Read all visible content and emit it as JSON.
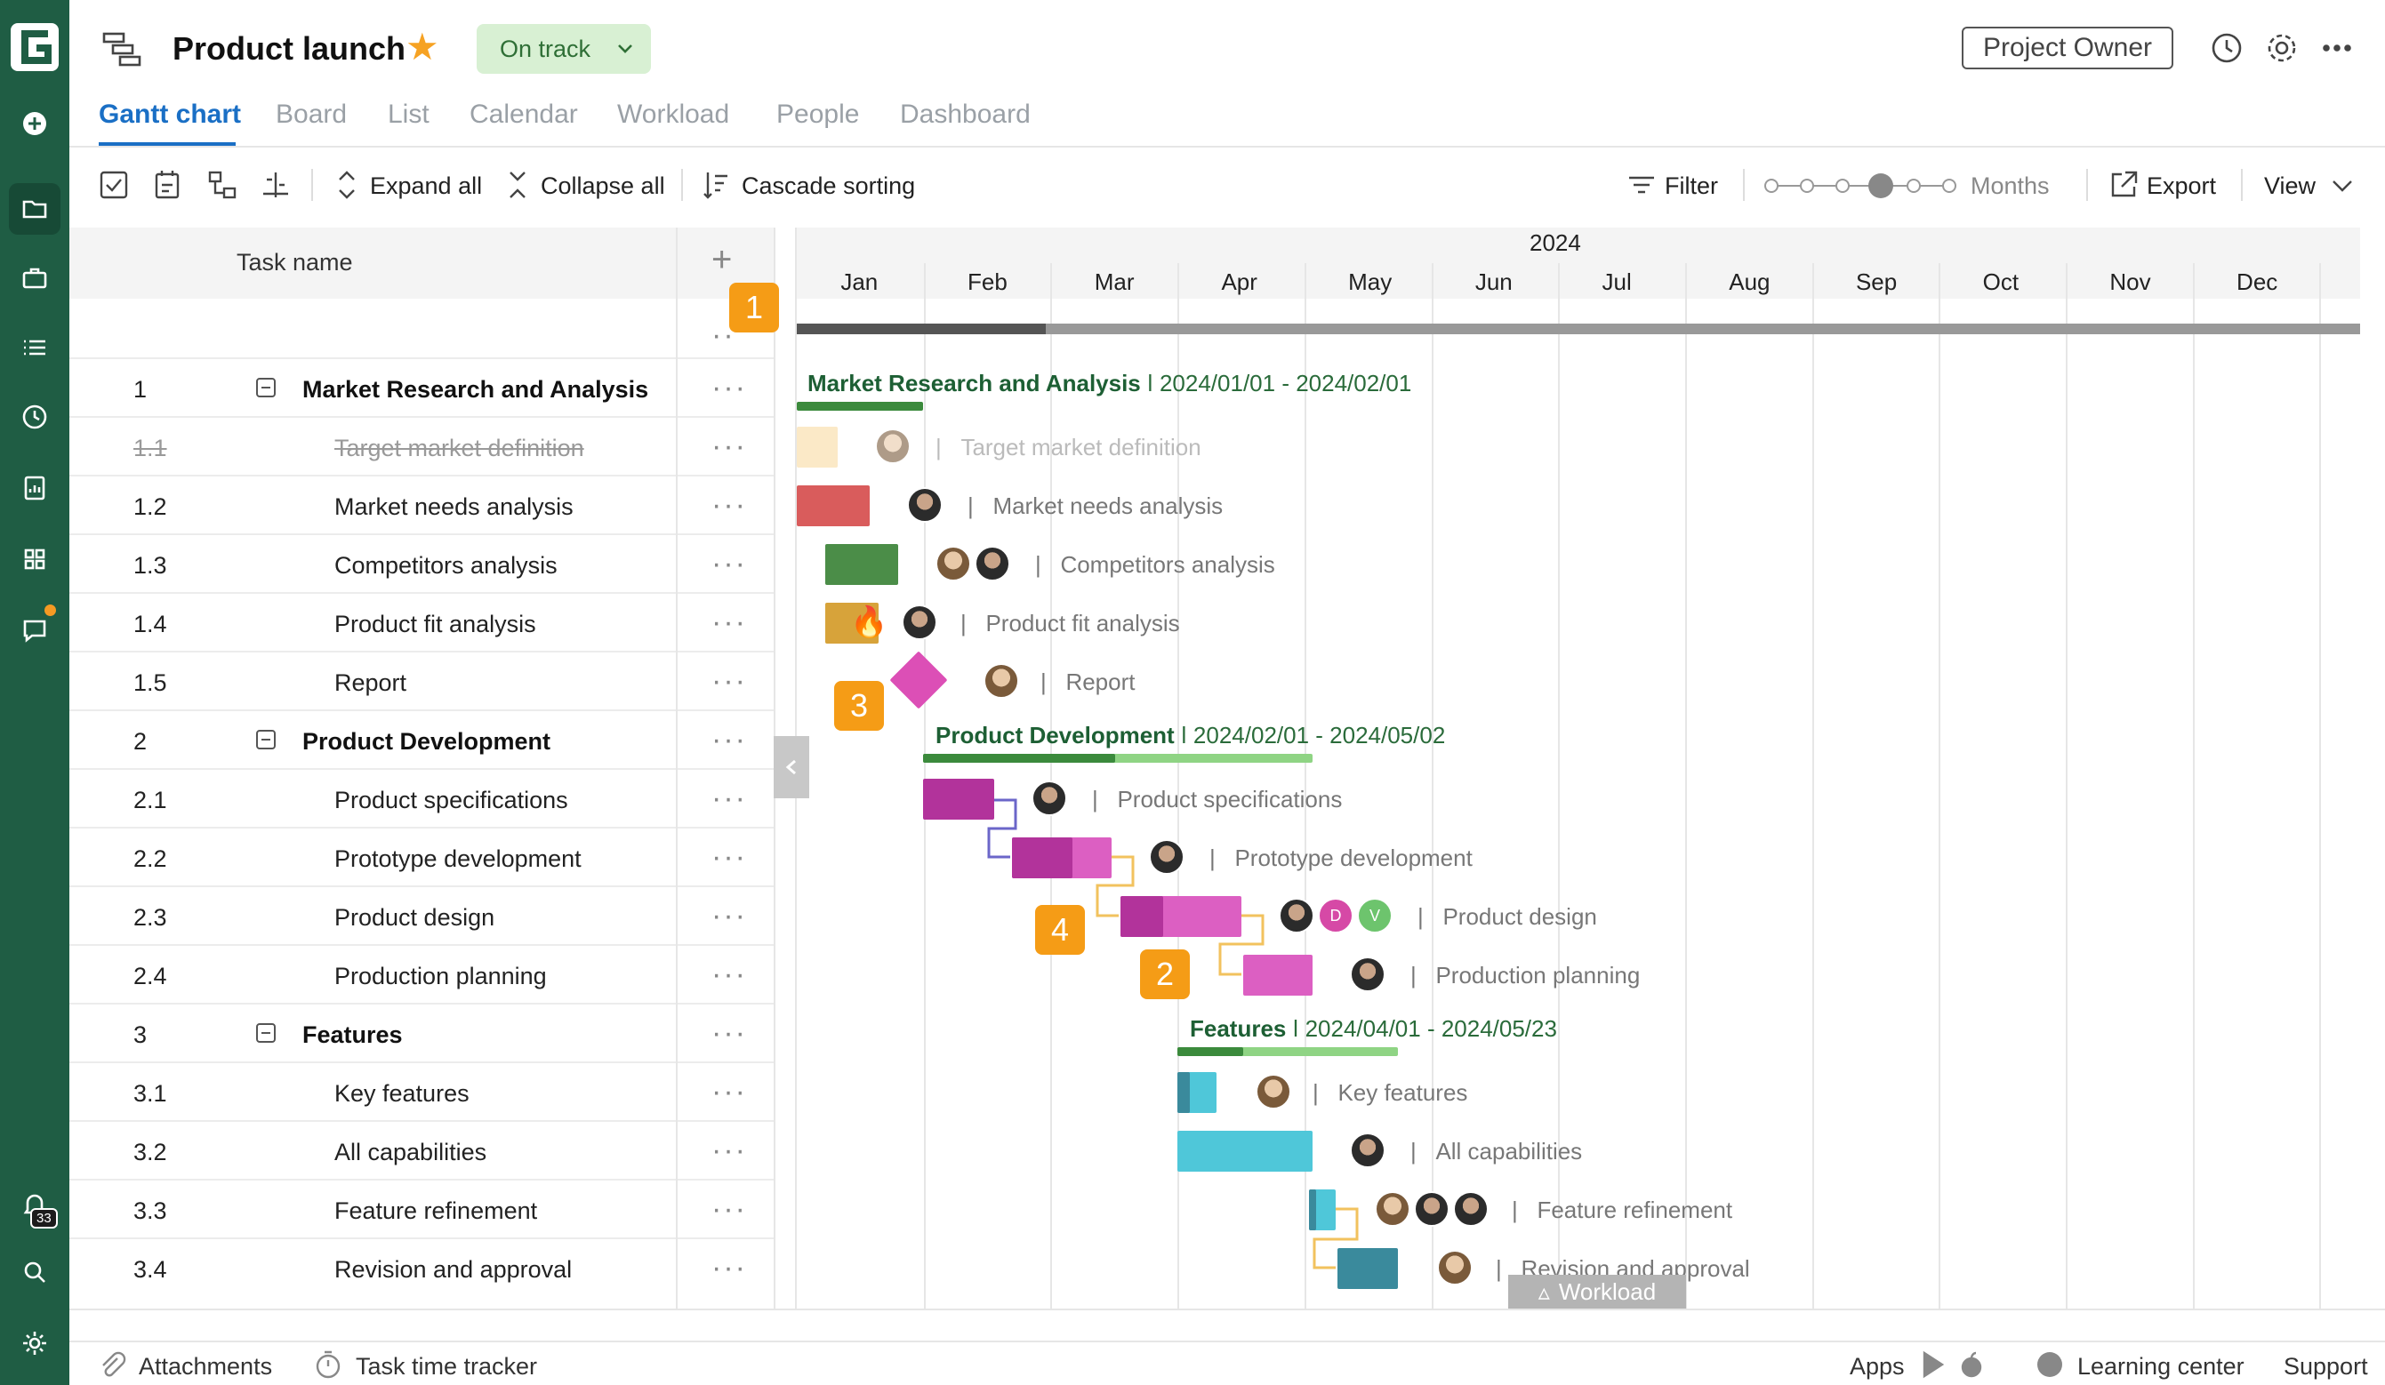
{
  "app": {
    "project_title": "Product launch",
    "status": "On track",
    "owner_button": "Project Owner",
    "accent_color": "#1a6fc5",
    "sidebar_color": "#1f5d44",
    "notifications_count": "33"
  },
  "tabs": [
    "Gantt chart",
    "Board",
    "List",
    "Calendar",
    "Workload",
    "People",
    "Dashboard"
  ],
  "toolbar": {
    "expand_all": "Expand all",
    "collapse_all": "Collapse all",
    "cascade_sorting": "Cascade sorting",
    "filter": "Filter",
    "zoom_label": "Months",
    "export": "Export",
    "view": "View"
  },
  "grid": {
    "column_task_name": "Task name",
    "rows": [
      {
        "num": "1",
        "name": "Market Research and Analysis",
        "group": true
      },
      {
        "num": "1.1",
        "name": "Target market definition",
        "struck": true
      },
      {
        "num": "1.2",
        "name": "Market needs analysis"
      },
      {
        "num": "1.3",
        "name": "Competitors analysis"
      },
      {
        "num": "1.4",
        "name": "Product fit analysis"
      },
      {
        "num": "1.5",
        "name": "Report"
      },
      {
        "num": "2",
        "name": "Product Development",
        "group": true
      },
      {
        "num": "2.1",
        "name": "Product specifications"
      },
      {
        "num": "2.2",
        "name": "Prototype development"
      },
      {
        "num": "2.3",
        "name": "Product design"
      },
      {
        "num": "2.4",
        "name": "Production planning"
      },
      {
        "num": "3",
        "name": "Features",
        "group": true
      },
      {
        "num": "3.1",
        "name": "Key features"
      },
      {
        "num": "3.2",
        "name": "All capabilities"
      },
      {
        "num": "3.3",
        "name": "Feature refinement"
      },
      {
        "num": "3.4",
        "name": "Revision and approval"
      }
    ]
  },
  "timeline": {
    "year": "2024",
    "months": [
      "Jan",
      "Feb",
      "Mar",
      "Apr",
      "May",
      "Jun",
      "Jul",
      "Aug",
      "Sep",
      "Oct",
      "Nov",
      "Dec"
    ],
    "groups": [
      {
        "name": "Market Research and Analysis",
        "dates": "2024/01/01 - 2024/02/01"
      },
      {
        "name": "Product Development",
        "dates": "2024/02/01 - 2024/05/02"
      },
      {
        "name": "Features",
        "dates": "2024/04/01 - 2024/05/23"
      }
    ],
    "task_labels": [
      "Target market definition",
      "Market needs analysis",
      "Competitors analysis",
      "Product fit analysis",
      "Report",
      "Product specifications",
      "Prototype development",
      "Product design",
      "Production planning",
      "Key features",
      "All capabilities",
      "Feature refinement",
      "Revision and approval"
    ],
    "avatar_letters": [
      "D",
      "V"
    ],
    "callouts": [
      "1",
      "2",
      "3",
      "4"
    ],
    "workload_tab": "Workload"
  },
  "footer": {
    "attachments": "Attachments",
    "time_tracker": "Task time tracker",
    "apps": "Apps",
    "learning_center": "Learning center",
    "support": "Support"
  }
}
